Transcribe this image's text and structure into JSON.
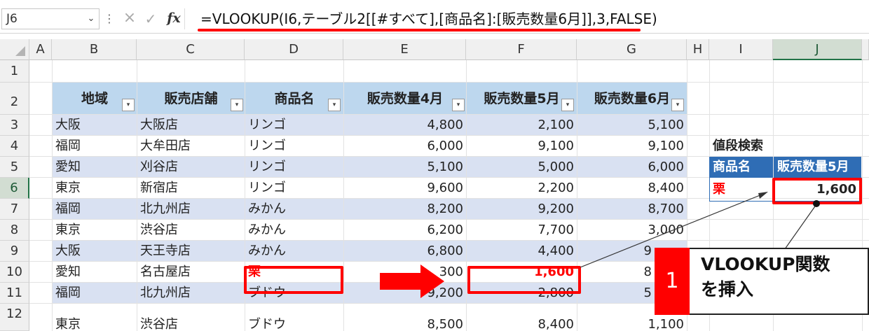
{
  "formula_bar": {
    "name_box": "J6",
    "chevron": "⌄",
    "dots": "⋮",
    "cancel_icon": "×",
    "enter_icon": "✓",
    "fx_label": "fx",
    "formula": "=VLOOKUP(I6,テーブル2[[#すべて],[商品名]:[販売数量6月]],3,FALSE)"
  },
  "columns": [
    "A",
    "B",
    "C",
    "D",
    "E",
    "F",
    "G",
    "H",
    "I",
    "J"
  ],
  "selected_column": "J",
  "rows": [
    "1",
    "2",
    "3",
    "4",
    "5",
    "6",
    "7",
    "8",
    "9",
    "10",
    "11",
    "12"
  ],
  "selected_row": "6",
  "table": {
    "headers": [
      "地域",
      "販売店舗",
      "商品名",
      "販売数量4月",
      "販売数量5月",
      "販売数量6月"
    ],
    "filter_icon": "▾",
    "rows": [
      [
        "大阪",
        "大阪店",
        "リンゴ",
        "4,800",
        "2,100",
        "5,100"
      ],
      [
        "福岡",
        "大牟田店",
        "リンゴ",
        "6,000",
        "9,100",
        "9,100"
      ],
      [
        "愛知",
        "刈谷店",
        "リンゴ",
        "5,100",
        "5,000",
        "6,000"
      ],
      [
        "東京",
        "新宿店",
        "リンゴ",
        "9,600",
        "2,200",
        "8,400"
      ],
      [
        "福岡",
        "北九州店",
        "みかん",
        "8,200",
        "9,200",
        "8,700"
      ],
      [
        "東京",
        "渋谷店",
        "みかん",
        "6,200",
        "7,700",
        "3,000"
      ],
      [
        "大阪",
        "天王寺店",
        "みかん",
        "6,800",
        "4,400",
        "9"
      ],
      [
        "愛知",
        "名古屋店",
        "栗",
        "",
        "1,600",
        "8"
      ],
      [
        "福岡",
        "北九州店",
        "ブドウ",
        "9,200",
        "2,800",
        "5"
      ],
      [
        "東京",
        "渋谷店",
        "ブドウ",
        "8,500",
        "8,400",
        "1,100"
      ]
    ],
    "partial_e10": "300"
  },
  "lookup": {
    "title": "値段検索",
    "header_item": "商品名",
    "header_value": "販売数量5月",
    "item": "栗",
    "value": "1,600"
  },
  "callout": {
    "number": "1",
    "line1": "VLOOKUP関数",
    "line2": "を挿入"
  },
  "colors": {
    "accent_red": "#ff0000",
    "table_header": "#bdd7ee",
    "band": "#d9e1f2",
    "lookup_header": "#2f6db5",
    "excel_green": "#217346"
  }
}
